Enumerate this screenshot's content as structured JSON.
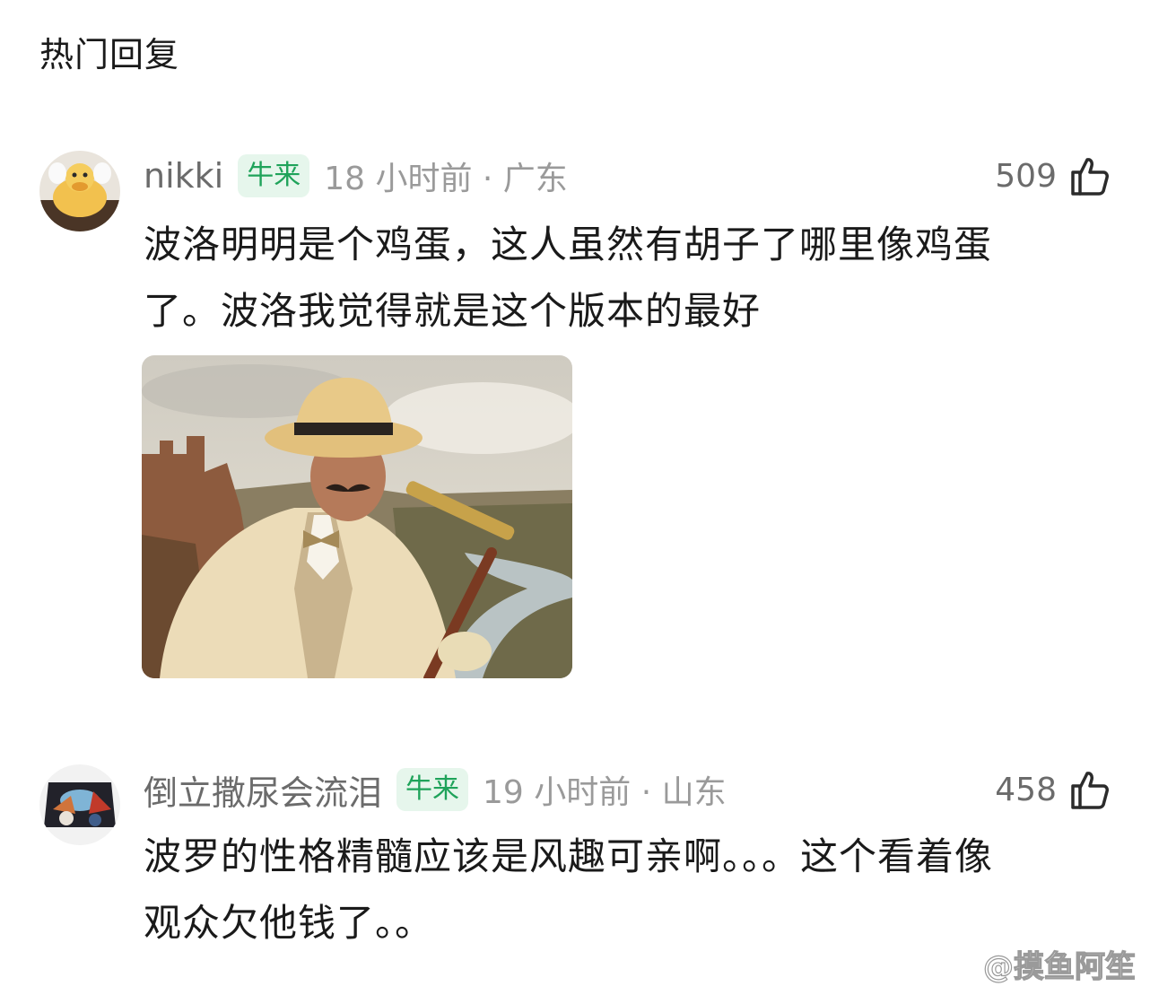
{
  "section_title": "热门回复",
  "comments": [
    {
      "username": "nikki",
      "badge": "牛来",
      "time_location": "18 小时前 · 广东",
      "likes": "509",
      "text_lines": [
        "波洛明明是个鸡蛋，这人虽然有胡子了哪里像鸡蛋",
        "了。波洛我觉得就是这个版本的最好"
      ],
      "icons": {
        "avatar": "duck-avatar",
        "like": "thumbs-up-icon"
      }
    },
    {
      "username": "倒立撒尿会流泪",
      "badge": "牛来",
      "time_location": "19 小时前 · 山东",
      "likes": "458",
      "text_lines": [
        "波罗的性格精髓应该是风趣可亲啊。。。这个看着像",
        "观众欠他钱了。。"
      ],
      "icons": {
        "avatar": "anime-avatar",
        "like": "thumbs-up-icon"
      }
    }
  ],
  "watermark": "@摸鱼阿笙",
  "colors": {
    "badge_bg": "#e6f6ec",
    "badge_text": "#1fa35a",
    "meta_text": "#9a9a9a"
  }
}
